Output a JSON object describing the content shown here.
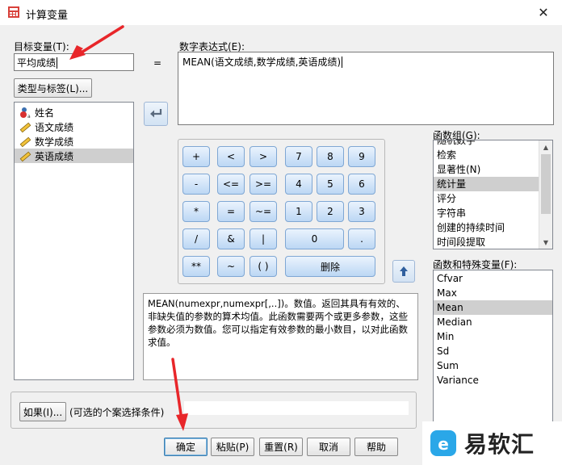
{
  "window": {
    "title": "计算变量",
    "close_glyph": "✕"
  },
  "target": {
    "label": "目标变量(T):",
    "value": "平均成绩",
    "equals": "="
  },
  "type_label_button": "类型与标签(L)...",
  "variables": [
    {
      "name": "姓名",
      "icon": "string-variable-icon"
    },
    {
      "name": "语文成绩",
      "icon": "scale-variable-icon"
    },
    {
      "name": "数学成绩",
      "icon": "scale-variable-icon"
    },
    {
      "name": "英语成绩",
      "icon": "scale-variable-icon",
      "selected": true
    }
  ],
  "expression": {
    "label": "数字表达式(E):",
    "value": "MEAN(语文成绩,数学成绩,英语成绩)"
  },
  "keypad": {
    "rows": [
      [
        "+",
        "<",
        ">",
        "7",
        "8",
        "9"
      ],
      [
        "-",
        "<=",
        ">=",
        "4",
        "5",
        "6"
      ],
      [
        "*",
        "=",
        "~=",
        "1",
        "2",
        "3"
      ],
      [
        "/",
        "&",
        "|",
        "0",
        "."
      ],
      [
        "**",
        "~",
        "( )",
        "删除"
      ]
    ]
  },
  "function_group": {
    "label": "函数组(G):",
    "items": [
      "随机数字",
      "检索",
      "显著性(N)",
      "统计量",
      "评分",
      "字符串",
      "创建的持续时间",
      "时间段提取"
    ],
    "selected_index": 3
  },
  "functions": {
    "label": "函数和特殊变量(F):",
    "items": [
      "Cfvar",
      "Max",
      "Mean",
      "Median",
      "Min",
      "Sd",
      "Sum",
      "Variance"
    ],
    "selected_index": 2
  },
  "description": "MEAN(numexpr,numexpr[,..])。数值。返回其具有有效的、非缺失值的参数的算术均值。此函数需要两个或更多参数，这些参数必须为数值。您可以指定有效参数的最小数目，以对此函数求值。",
  "if_section": {
    "button": "如果(I)...",
    "condition": "(可选的个案选择条件)"
  },
  "footer_buttons": {
    "ok": "确定",
    "paste": "粘贴(P)",
    "reset": "重置(R)",
    "cancel": "取消",
    "help": "帮助"
  },
  "watermark": {
    "text": "易软汇"
  },
  "colors": {
    "selection": "#cfcfcf",
    "keypad": "#bcd7f4",
    "annotation": "#e8262a"
  }
}
